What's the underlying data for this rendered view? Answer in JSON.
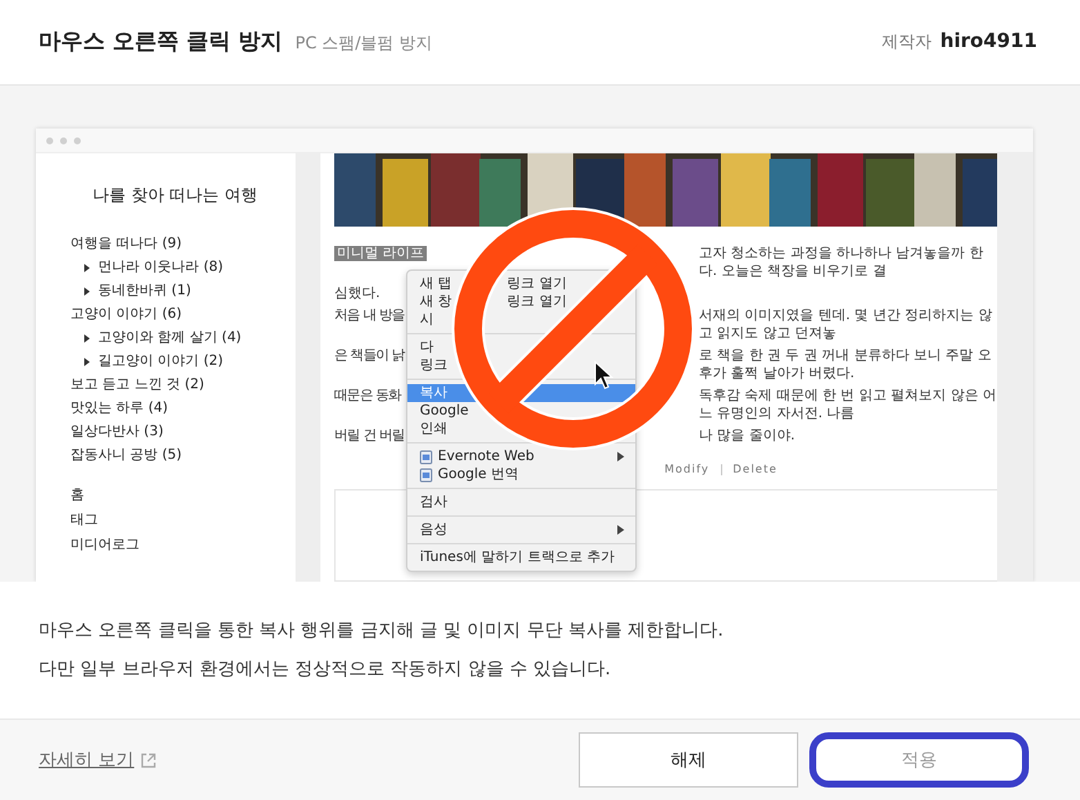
{
  "header": {
    "title": "마우스 오른쪽 클릭 방지",
    "subtitle": "PC 스팸/블펌 방지",
    "author_label": "제작자",
    "author": "hiro4911"
  },
  "preview": {
    "blog_title": "나를 찾아 떠나는 여행",
    "categories": [
      {
        "label": "여행을 떠나다 (9)",
        "children": [
          {
            "label": "먼나라 이웃나라 (8)"
          },
          {
            "label": "동네한바퀴 (1)"
          }
        ]
      },
      {
        "label": "고양이 이야기 (6)",
        "children": [
          {
            "label": "고양이와 함께 살기 (4)"
          },
          {
            "label": "길고양이 이야기 (2)"
          }
        ]
      },
      {
        "label": "보고 듣고 느낀 것 (2)"
      },
      {
        "label": "맛있는 하루 (4)"
      },
      {
        "label": "일상다반사 (3)"
      },
      {
        "label": "잡동사니 공방 (5)"
      }
    ],
    "nav": [
      "홈",
      "태그",
      "미디어로그"
    ],
    "lines": [
      {
        "kind": "split",
        "highlight": "미니멀 라이프",
        "right": "고자 청소하는 과정을 하나하나 남겨놓을까 한다. 오늘은 책장을 비우기로 결"
      },
      {
        "kind": "full",
        "text": "심했다."
      },
      {
        "kind": "split",
        "left": "처음 내 방을",
        "right": "서재의 이미지였을 텐데. 몇 년간 정리하지는 않고 읽지도 않고 던져놓"
      },
      {
        "kind": "split",
        "left": "은 책들이 낡",
        "right": "로 책을 한 권 두 권 꺼내 분류하다 보니 주말 오후가 훌쩍 날아가 버렸다."
      },
      {
        "kind": "split",
        "left": "때문은 동화",
        "right": "독후감 숙제 때문에 한 번 읽고 펼쳐보지 않은 어느 유명인의 자서전. 나름"
      },
      {
        "kind": "split",
        "left": "버릴 건 버릴",
        "right": "나 많을 줄이야."
      }
    ],
    "post_actions": [
      "Modify",
      "Delete"
    ],
    "context_menu": {
      "items": [
        {
          "kind": "item",
          "parts": [
            "새 탭",
            "링크 열기"
          ],
          "selected": false
        },
        {
          "kind": "item",
          "parts": [
            "새 창",
            "링크 열기"
          ],
          "selected": false
        },
        {
          "kind": "item",
          "parts": [
            "시"
          ],
          "selected": false
        },
        {
          "kind": "separator"
        },
        {
          "kind": "item",
          "parts": [
            "다"
          ],
          "selected": false
        },
        {
          "kind": "item",
          "parts": [
            "링크"
          ],
          "selected": false
        },
        {
          "kind": "separator"
        },
        {
          "kind": "item",
          "parts": [
            "복사"
          ],
          "selected": true
        },
        {
          "kind": "item",
          "parts": [
            "Google"
          ],
          "selected": false
        },
        {
          "kind": "item",
          "parts": [
            "인쇄"
          ],
          "selected": false
        },
        {
          "kind": "separator"
        },
        {
          "kind": "app",
          "parts": [
            "Evernote Web"
          ],
          "selected": false,
          "submenu": true
        },
        {
          "kind": "app",
          "parts": [
            "Google 번역"
          ],
          "selected": false,
          "submenu": false
        },
        {
          "kind": "separator"
        },
        {
          "kind": "item",
          "parts": [
            "검사"
          ],
          "selected": false,
          "submenu": false
        },
        {
          "kind": "separator"
        },
        {
          "kind": "item",
          "parts": [
            "음성"
          ],
          "selected": false,
          "submenu": true
        },
        {
          "kind": "separator"
        },
        {
          "kind": "item",
          "parts": [
            "iTunes에 말하기 트랙으로 추가"
          ],
          "selected": false,
          "submenu": false
        }
      ]
    }
  },
  "description": [
    "마우스 오른쪽 클릭을 통한 복사 행위를 금지해 글 및 이미지 무단 복사를 제한합니다.",
    "다만 일부 브라우저 환경에서는 정상적으로 작동하지 않을 수 있습니다."
  ],
  "footer": {
    "link": "자세히 보기",
    "buttons": [
      {
        "label": "해제",
        "disabled": false,
        "highlighted": false
      },
      {
        "label": "적용",
        "disabled": true,
        "highlighted": true
      }
    ]
  }
}
